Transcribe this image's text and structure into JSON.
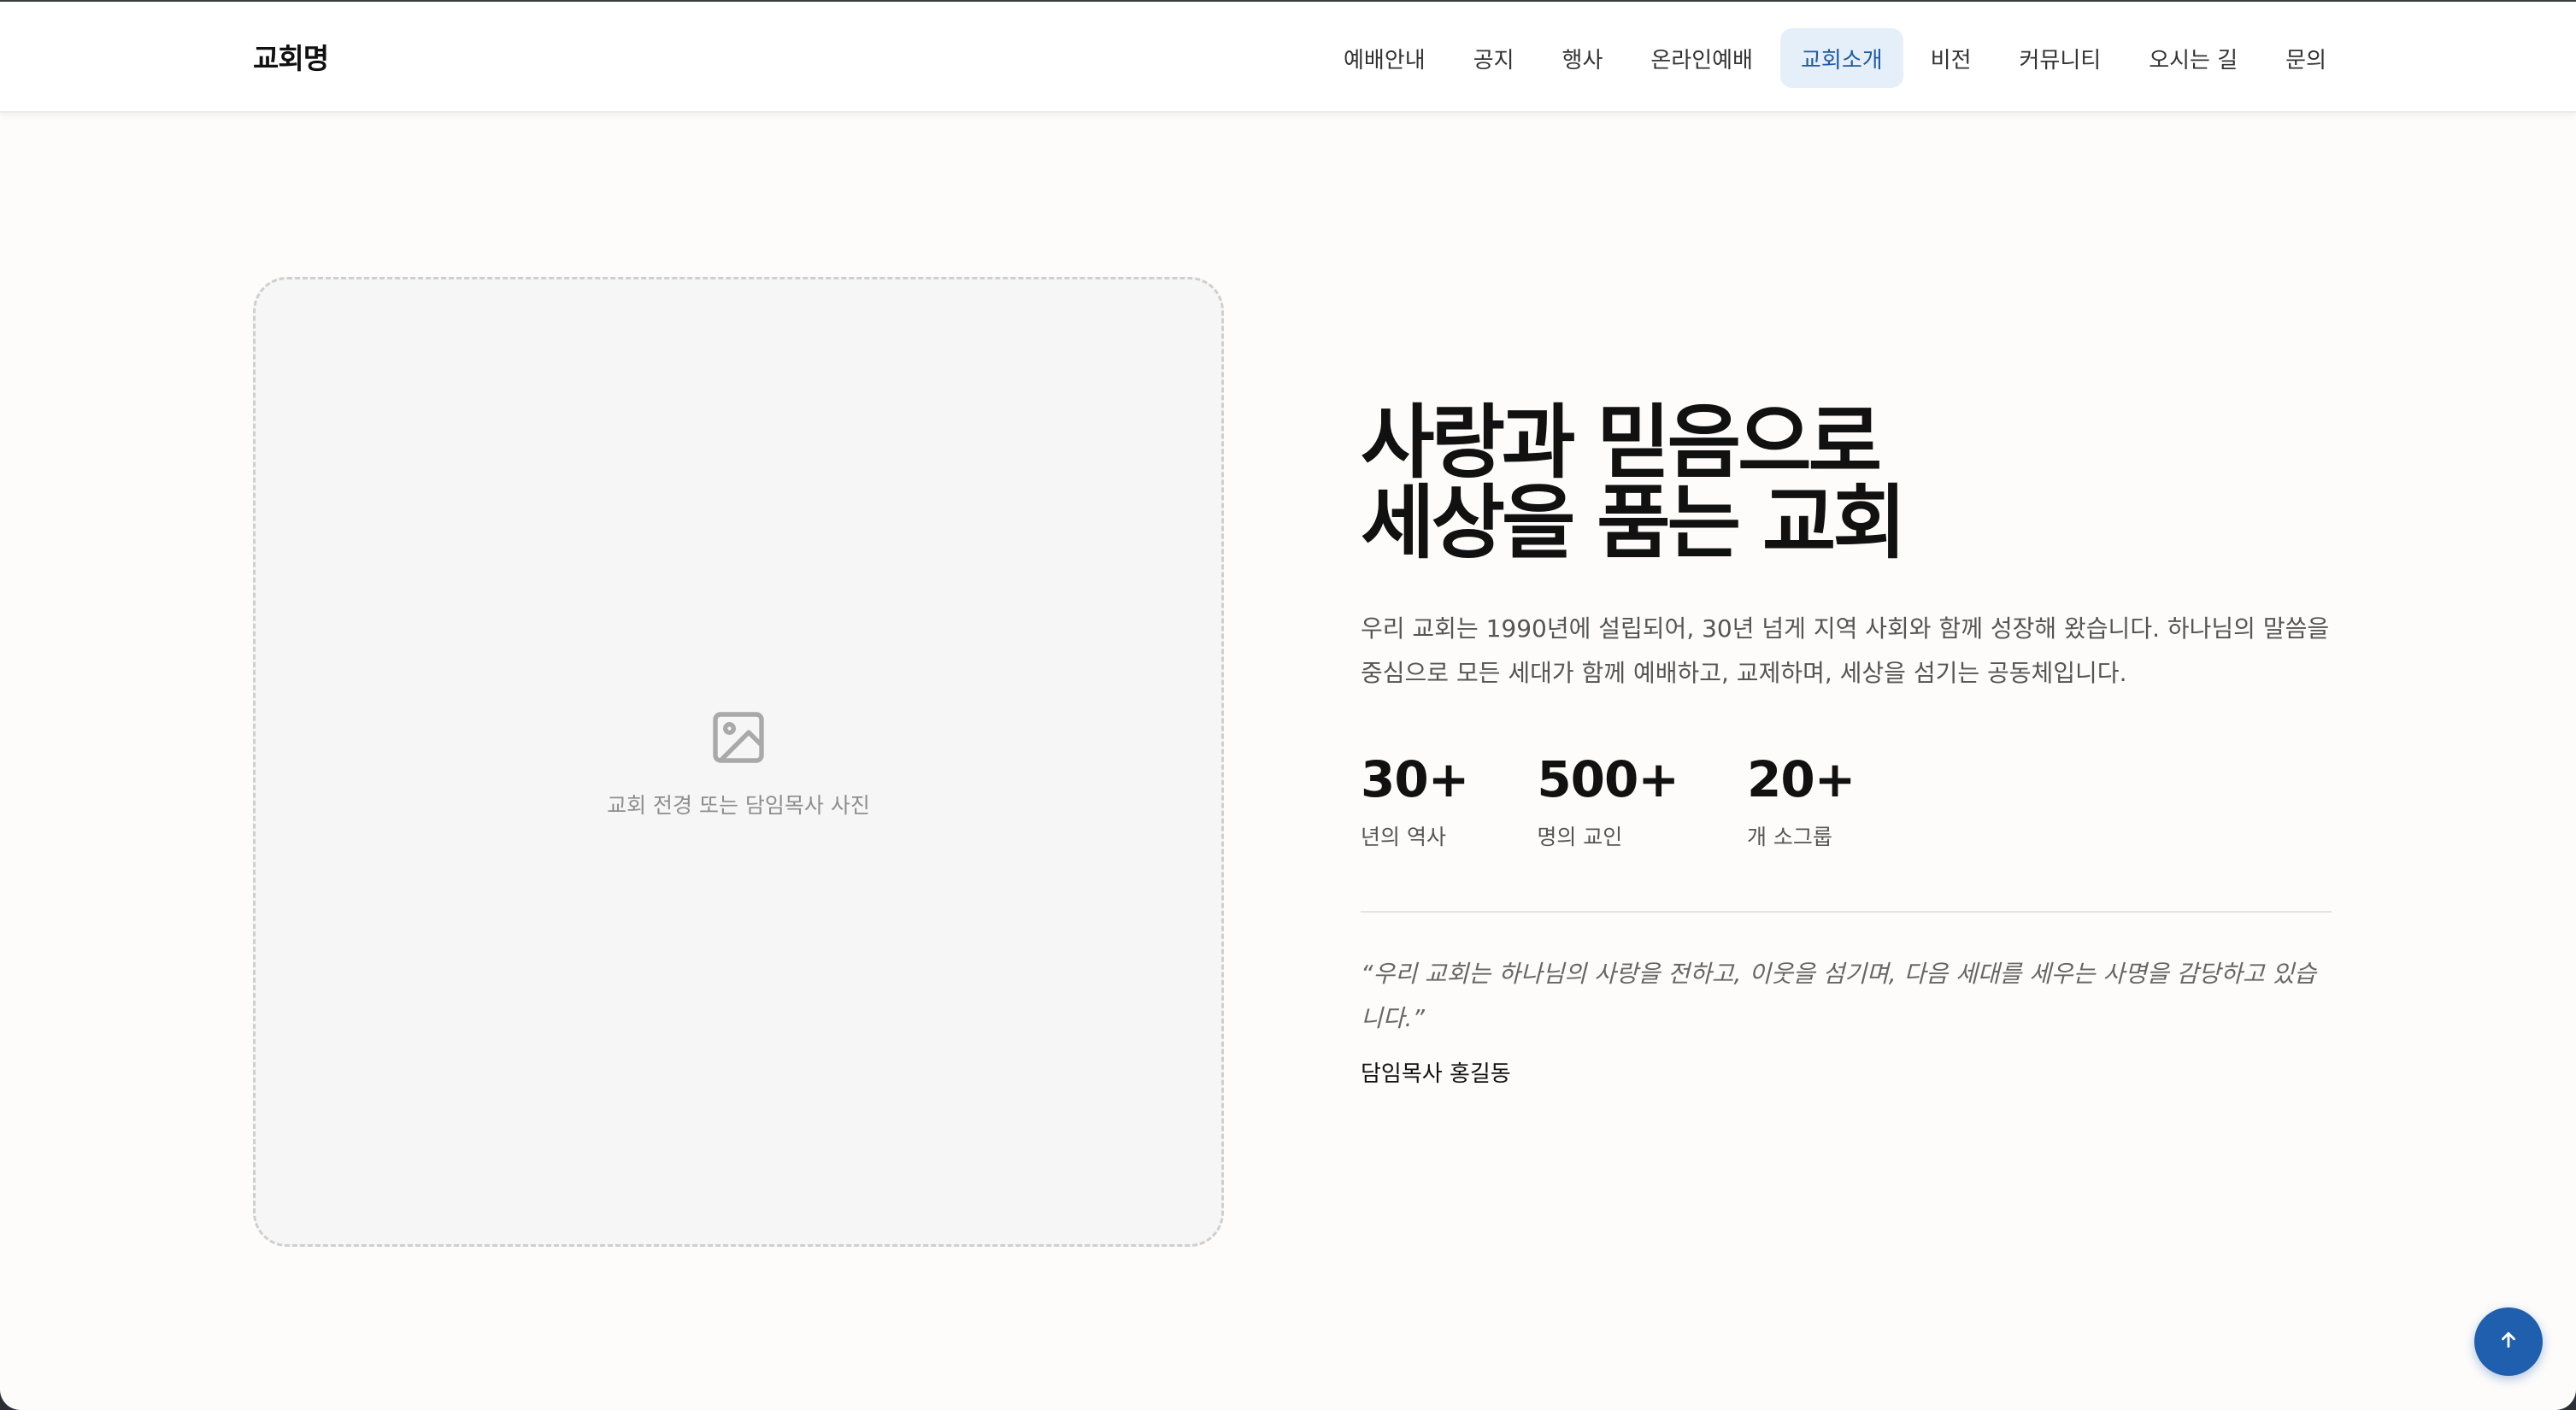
{
  "header": {
    "logo": "교회명",
    "nav": [
      {
        "label": "예배안내",
        "active": false
      },
      {
        "label": "공지",
        "active": false
      },
      {
        "label": "행사",
        "active": false
      },
      {
        "label": "온라인예배",
        "active": false
      },
      {
        "label": "교회소개",
        "active": true
      },
      {
        "label": "비전",
        "active": false
      },
      {
        "label": "커뮤니티",
        "active": false
      },
      {
        "label": "오시는 길",
        "active": false
      },
      {
        "label": "문의",
        "active": false
      }
    ]
  },
  "photo": {
    "icon": "image-icon",
    "caption": "교회 전경 또는 담임목사 사진"
  },
  "about": {
    "headline_line1": "사랑과 믿음으로",
    "headline_line2": "세상을 품는 교회",
    "description": "우리 교회는 1990년에 설립되어, 30년 넘게 지역 사회와 함께 성장해 왔습니다. 하나님의 말씀을 중심으로 모든 세대가 함께 예배하고, 교제하며, 세상을 섬기는 공동체입니다.",
    "stats": [
      {
        "value": "30+",
        "label": "년의 역사"
      },
      {
        "value": "500+",
        "label": "명의 교인"
      },
      {
        "value": "20+",
        "label": "개 소그룹"
      }
    ],
    "quote": "“우리 교회는 하나님의 사랑을 전하고, 이웃을 섬기며, 다음 세대를 세우는 사명을 감당하고 있습니다.”",
    "author": "담임목사 홍길동"
  },
  "scroll_top": {
    "icon": "arrow-up-icon"
  },
  "colors": {
    "accent": "#1f5fae",
    "active_nav_bg": "#e5eff9",
    "active_nav_text": "#1f5aa3",
    "text_primary": "#111111",
    "text_secondary": "#555555"
  }
}
